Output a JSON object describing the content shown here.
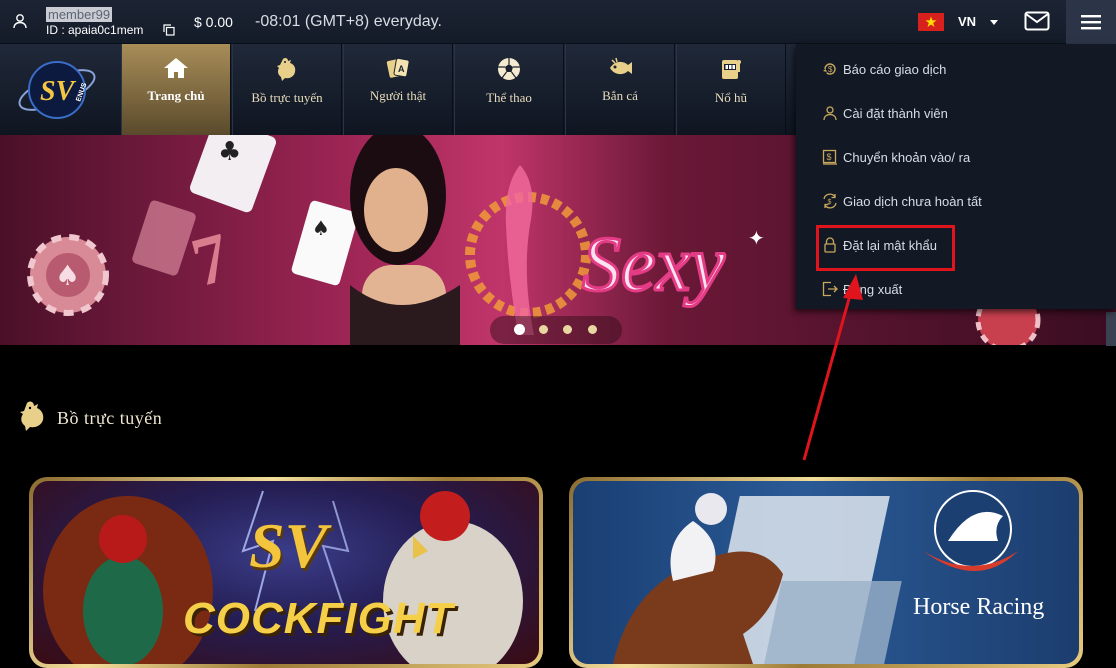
{
  "topbar": {
    "username": "member99",
    "userid_label": "ID : apaia0c1mem",
    "balance": "$ 0.00",
    "timezone": "-08:01 (GMT+8) everyday.",
    "language": "VN"
  },
  "nav": {
    "items": [
      {
        "label": "Trang chủ",
        "icon": "home-icon"
      },
      {
        "label": "Bồ trực tuyến",
        "icon": "rooster-icon"
      },
      {
        "label": "Người thật",
        "icon": "cards-icon"
      },
      {
        "label": "Thể thao",
        "icon": "soccer-ball-icon"
      },
      {
        "label": "Bắn cá",
        "icon": "fish-icon"
      },
      {
        "label": "Nổ hũ",
        "icon": "slot-machine-icon"
      }
    ]
  },
  "banner": {
    "text": "Sexy",
    "slides": 4,
    "active_slide": 1
  },
  "section": {
    "title": "Bồ trực tuyến"
  },
  "games": {
    "cockfight": {
      "brand": "SV",
      "title": "COCKFIGHT"
    },
    "horse": {
      "title": "Horse Racing"
    }
  },
  "dropdown": {
    "items": [
      {
        "label": "Báo cáo giao dịch",
        "icon": "report-icon"
      },
      {
        "label": "Cài đặt thành viên",
        "icon": "user-settings-icon"
      },
      {
        "label": "Chuyển khoản vào/ ra",
        "icon": "transfer-icon"
      },
      {
        "label": "Giao dịch chưa hoàn tất",
        "icon": "pending-icon"
      },
      {
        "label": "Đặt lại mật khẩu",
        "icon": "lock-icon"
      },
      {
        "label": "Đăng xuất",
        "icon": "logout-icon"
      }
    ]
  },
  "colors": {
    "accent_gold": "#c9a85c",
    "highlight_red": "#e0141c",
    "topbar": "#1c2434"
  }
}
